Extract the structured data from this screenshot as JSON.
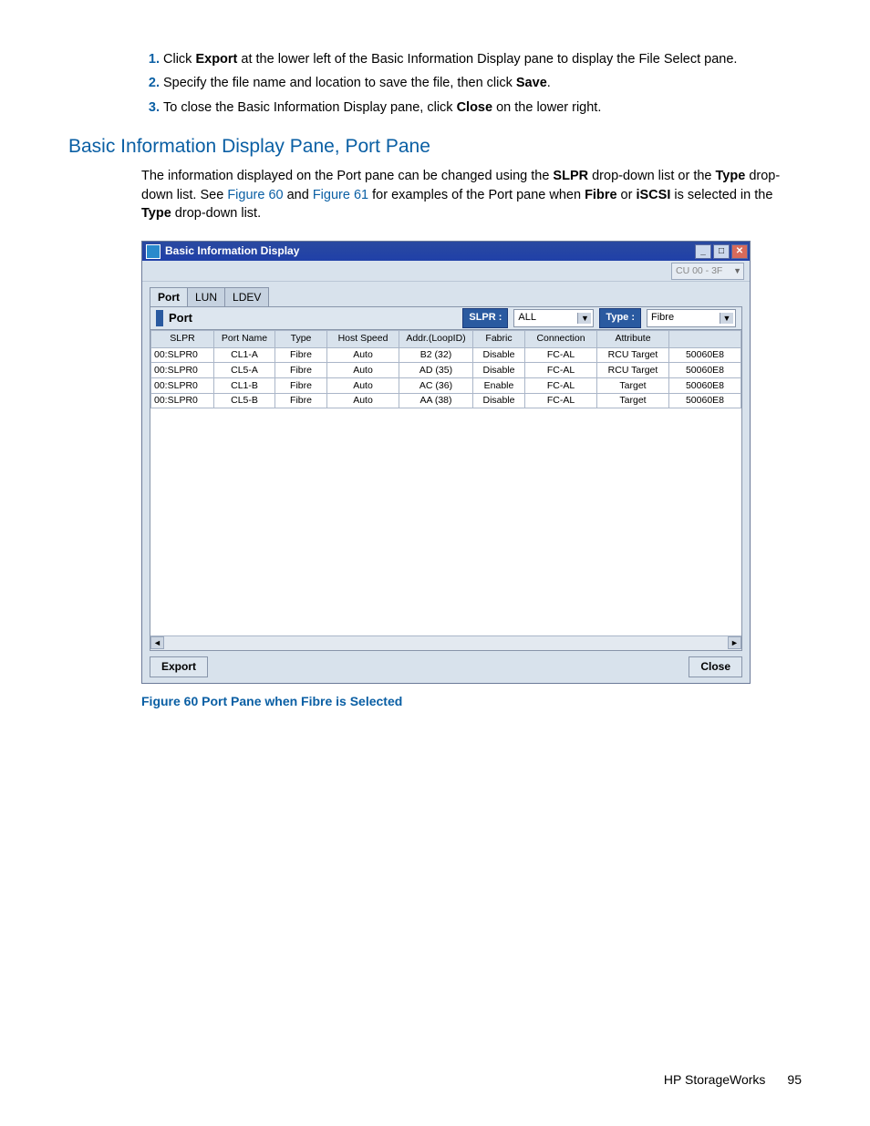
{
  "steps": [
    {
      "n": "1.",
      "before": "Click ",
      "bold": "Export",
      "after": " at the lower left of the Basic Information Display pane to display the File Select pane."
    },
    {
      "n": "2.",
      "before": "Specify the file name and location to save the file, then click ",
      "bold": "Save",
      "after": "."
    },
    {
      "n": "3.",
      "before": "To close the Basic Information Display pane, click ",
      "bold": "Close",
      "after": " on the lower right."
    }
  ],
  "section_title": "Basic Information Display Pane, Port Pane",
  "para": {
    "t1": "The information displayed on the Port pane can be changed using the ",
    "b1": "SLPR",
    "t2": " drop-down list or the ",
    "b2": "Type",
    "t3": " drop-down list.  See ",
    "l1": "Figure 60",
    "t4": " and ",
    "l2": "Figure 61",
    "t5": " for examples of the Port pane when ",
    "b3": "Fibre",
    "t6": " or ",
    "b4": "iSCSI",
    "t7": " is selected in the ",
    "b5": "Type",
    "t8": " drop-down list."
  },
  "window": {
    "title": "Basic Information Display",
    "cu_value": "CU 00 - 3F",
    "tabs": [
      "Port",
      "LUN",
      "LDEV"
    ],
    "pane_title": "Port",
    "slpr_label": "SLPR :",
    "slpr_value": "ALL",
    "type_label": "Type :",
    "type_value": "Fibre",
    "columns": [
      "SLPR",
      "Port Name",
      "Type",
      "Host Speed",
      "Addr.(LoopID)",
      "Fabric",
      "Connection",
      "Attribute",
      ""
    ],
    "rows": [
      [
        "00:SLPR0",
        "CL1-A",
        "Fibre",
        "Auto",
        "B2 (32)",
        "Disable",
        "FC-AL",
        "RCU Target",
        "50060E8"
      ],
      [
        "00:SLPR0",
        "CL5-A",
        "Fibre",
        "Auto",
        "AD (35)",
        "Disable",
        "FC-AL",
        "RCU Target",
        "50060E8"
      ],
      [
        "00:SLPR0",
        "CL1-B",
        "Fibre",
        "Auto",
        "AC (36)",
        "Enable",
        "FC-AL",
        "Target",
        "50060E8"
      ],
      [
        "00:SLPR0",
        "CL5-B",
        "Fibre",
        "Auto",
        "AA (38)",
        "Disable",
        "FC-AL",
        "Target",
        "50060E8"
      ]
    ],
    "export_btn": "Export",
    "close_btn": "Close"
  },
  "figcap": "Figure 60 Port Pane when Fibre is Selected",
  "footer_text": "HP StorageWorks",
  "footer_page": "95"
}
